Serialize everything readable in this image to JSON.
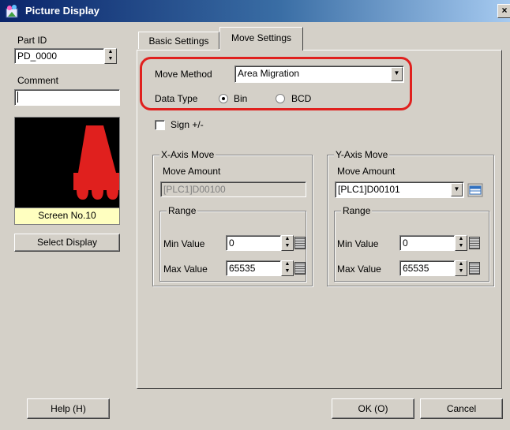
{
  "window": {
    "title": "Picture Display",
    "close_glyph": "×"
  },
  "left": {
    "part_id_label": "Part ID",
    "part_id_value": "PD_0000",
    "comment_label": "Comment",
    "comment_value": "",
    "preview_caption": "Screen No.10",
    "select_display_label": "Select Display"
  },
  "tabs": [
    {
      "label": "Basic Settings"
    },
    {
      "label": "Move Settings"
    }
  ],
  "move": {
    "method_label": "Move Method",
    "method_value": "Area Migration",
    "data_type_label": "Data Type",
    "radio_bin": "Bin",
    "radio_bcd": "BCD",
    "selected": "Bin",
    "sign_label": "Sign +/-"
  },
  "x_axis": {
    "title": "X-Axis Move",
    "amount_label": "Move Amount",
    "amount_value": "[PLC1]D00100",
    "range_title": "Range",
    "min_label": "Min Value",
    "min_value": "0",
    "max_label": "Max Value",
    "max_value": "65535"
  },
  "y_axis": {
    "title": "Y-Axis Move",
    "amount_label": "Move Amount",
    "amount_value": "[PLC1]D00101",
    "range_title": "Range",
    "min_label": "Min Value",
    "min_value": "0",
    "max_label": "Max Value",
    "max_value": "65535"
  },
  "footer": {
    "help_label": "Help (H)",
    "ok_label": "OK (O)",
    "cancel_label": "Cancel"
  },
  "colors": {
    "highlight": "#e0201e",
    "preview_bg": "#000000",
    "preview_shape": "#e0201e",
    "caption_bg": "#ffffc0"
  },
  "icons": {
    "title_icon": "picture-display-icon",
    "address_icon": "address-book-icon",
    "grid_icon": "keypad-grid-icon"
  }
}
